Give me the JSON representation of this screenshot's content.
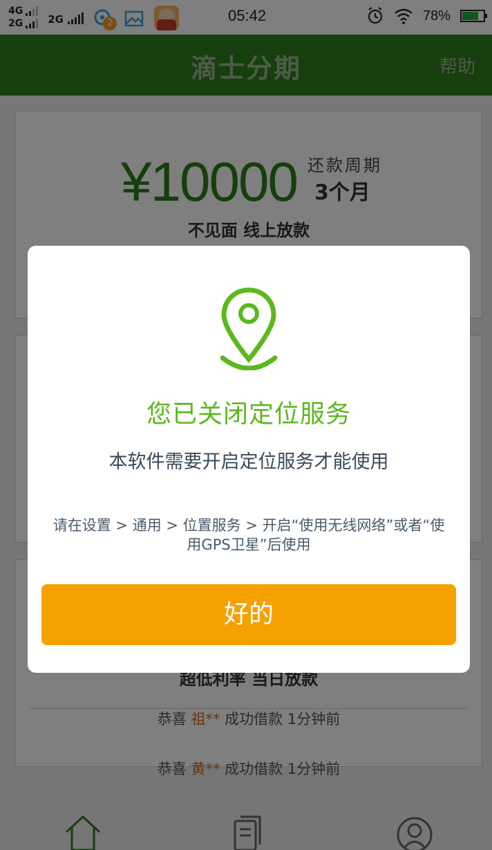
{
  "status_bar": {
    "net1": "4G",
    "net2": "2G",
    "net3": "2G",
    "notification_count": "2",
    "time": "05:42",
    "battery": "78%",
    "battery_level": 0.78
  },
  "header": {
    "title": "滴士分期",
    "help": "帮助"
  },
  "card1": {
    "amount": "¥10000",
    "period_label": "还款周期",
    "period_value": "3个月",
    "tagline": "不见面   线上放款"
  },
  "card3": {
    "tagline": "超低利率   当日放款",
    "ticker1_prefix": "恭喜 ",
    "ticker1_name": "祖**",
    "ticker1_suffix": " 成功借款 1分钟前",
    "ticker2_prefix": "恭喜 ",
    "ticker2_name": "黄**",
    "ticker2_suffix": " 成功借款 1分钟前"
  },
  "nav": {
    "items": [
      {
        "icon": "home-icon"
      },
      {
        "icon": "document-icon"
      },
      {
        "icon": "user-icon"
      }
    ]
  },
  "dialog": {
    "icon": "location-pin-icon",
    "title": "您已关闭定位服务",
    "subtitle": "本软件需要开启定位服务才能使用",
    "hint": "请在设置 > 通用 > 位置服务 > 开启“使用无线网络”或者“使用GPS卫星”后使用",
    "ok_label": "好的"
  },
  "colors": {
    "brand_green": "#2e7d1a",
    "dialog_green": "#5cb81e",
    "button_orange": "#f5a100"
  }
}
